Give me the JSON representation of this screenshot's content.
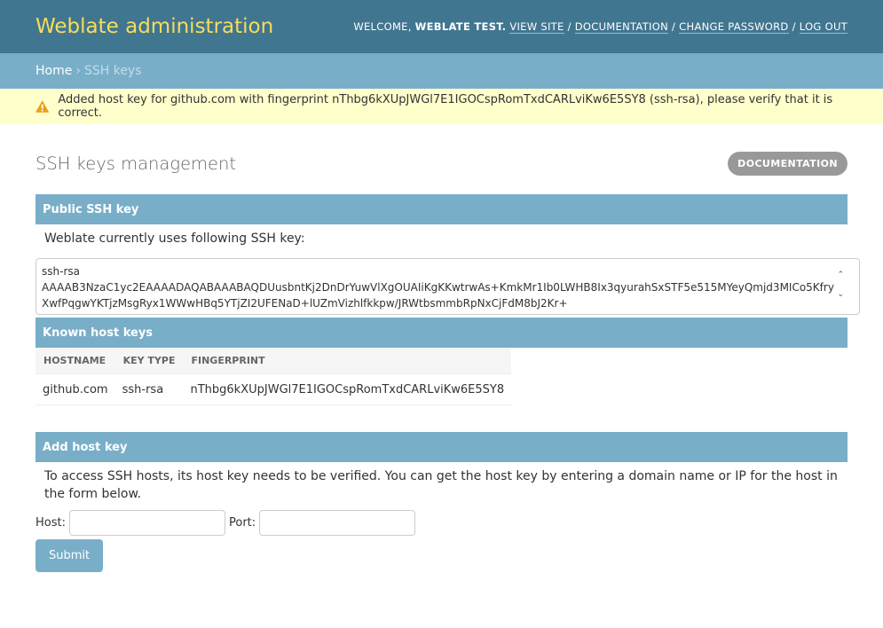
{
  "header": {
    "brand": "Weblate administration",
    "welcome": "Welcome,",
    "user": "Weblate Test.",
    "links": [
      "View site",
      "Documentation",
      "Change password",
      "Log out"
    ]
  },
  "breadcrumbs": {
    "home": "Home",
    "current": "SSH keys"
  },
  "message": {
    "icon": "warning-icon",
    "text": "Added host key for github.com with fingerprint nThbg6kXUpJWGl7E1IGOCspRomTxdCARLviKw6E5SY8 (ssh-rsa), please verify that it is correct."
  },
  "page": {
    "title": "SSH keys management",
    "doc_button": "Documentation"
  },
  "public_key": {
    "heading": "Public SSH key",
    "intro": "Weblate currently uses following SSH key:",
    "key": "ssh-rsa\nAAAAB3NzaC1yc2EAAAADAQABAAABAQDUusbntKj2DnDrYuwVlXgOUAIiKgKKwtrwAs+KmkMr1Ib0LWHB8Ix3qyurahSxSTF5e515MYeyQmjd3MICo5KfryXwfPqgwYKTjzMsgRyx1WWwHBq5YTjZI2UFENaD+lUZmVizhlfkkpw/JRWtbsmmbRpNxCjFdM8bJ2Kr+"
  },
  "known_hosts": {
    "heading": "Known host keys",
    "columns": [
      "Hostname",
      "Key type",
      "Fingerprint"
    ],
    "rows": [
      {
        "hostname": "github.com",
        "key_type": "ssh-rsa",
        "fingerprint": "nThbg6kXUpJWGl7E1IGOCspRomTxdCARLviKw6E5SY8"
      }
    ]
  },
  "add_host": {
    "heading": "Add host key",
    "intro": "To access SSH hosts, its host key needs to be verified. You can get the host key by entering a domain name or IP for the host in the form below.",
    "host_label": "Host:",
    "port_label": "Port:",
    "host_value": "",
    "port_value": "",
    "submit": "Submit"
  },
  "colors": {
    "header": "#417690",
    "brand": "#f5dd5d",
    "module": "#79aec8",
    "message": "#ffffcc",
    "warning": "#e6a118"
  }
}
